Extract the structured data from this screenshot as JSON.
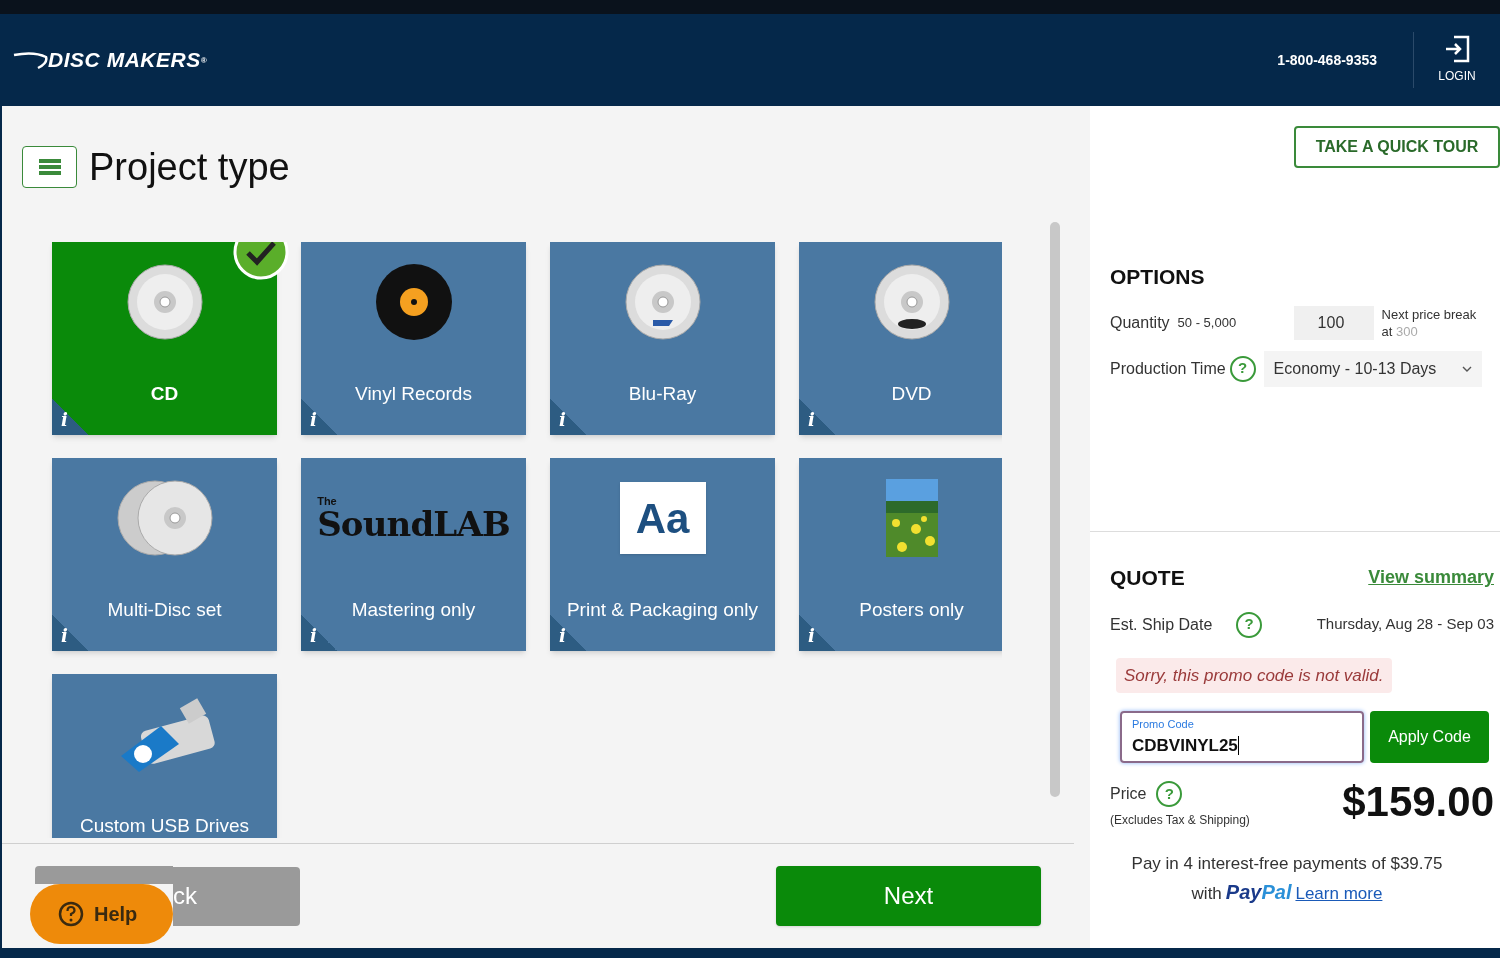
{
  "header": {
    "logo": "DISC MAKERS",
    "logo_mark": "®",
    "phone": "1-800-468-9353",
    "login": "LOGIN"
  },
  "page_title": "Project type",
  "tiles": [
    {
      "label": "CD",
      "selected": true,
      "kind": "cd",
      "info": "i"
    },
    {
      "label": "Vinyl Records",
      "selected": false,
      "kind": "vinyl",
      "info": "i"
    },
    {
      "label": "Blu-Ray",
      "selected": false,
      "kind": "bluray",
      "info": "i"
    },
    {
      "label": "DVD",
      "selected": false,
      "kind": "dvd",
      "info": "i"
    },
    {
      "label": "Multi-Disc set",
      "selected": false,
      "kind": "multi",
      "info": "i"
    },
    {
      "label": "Mastering only",
      "selected": false,
      "kind": "logo",
      "logo_small": "The",
      "logo_main": "SoundLAB",
      "info": "i"
    },
    {
      "label": "Print & Packaging only",
      "selected": false,
      "kind": "text",
      "sample": "Aa",
      "info": "i"
    },
    {
      "label": "Posters only",
      "selected": false,
      "kind": "picture",
      "info": "i"
    },
    {
      "label": "Custom USB Drives",
      "selected": false,
      "kind": "usb"
    }
  ],
  "back_button": "ck",
  "next_button": "Next",
  "help_button": "Help",
  "tour_button": "TAKE A QUICK TOUR",
  "options": {
    "title": "OPTIONS",
    "quantity_label": "Quantity",
    "quantity_range": "50 - 5,000",
    "quantity": "100",
    "next_break": "Next price break at",
    "next_break_value": "300",
    "production_label": "Production Time",
    "production_help": "?",
    "production_value": "Economy - 10-13 Days"
  },
  "quote": {
    "title": "QUOTE",
    "summary_link": "View summary",
    "ship_label": "Est. Ship Date",
    "ship_help": "?",
    "ship_date": "Thursday, Aug 28 - Sep 03",
    "error": "Sorry, this promo code is not valid.",
    "promo_label": "Promo Code",
    "promo_value": "CDBVINYL25",
    "apply_button": "Apply Code",
    "price_label": "Price",
    "price_help": "?",
    "price_note": "(Excludes Tax & Shipping)",
    "price": "$159.00",
    "paypal_line": "Pay in 4 interest-free payments of $39.75",
    "paypal_with": "with",
    "paypal_pay": "Pay",
    "paypal_pal": "Pal",
    "paypal_link": "Learn more"
  }
}
